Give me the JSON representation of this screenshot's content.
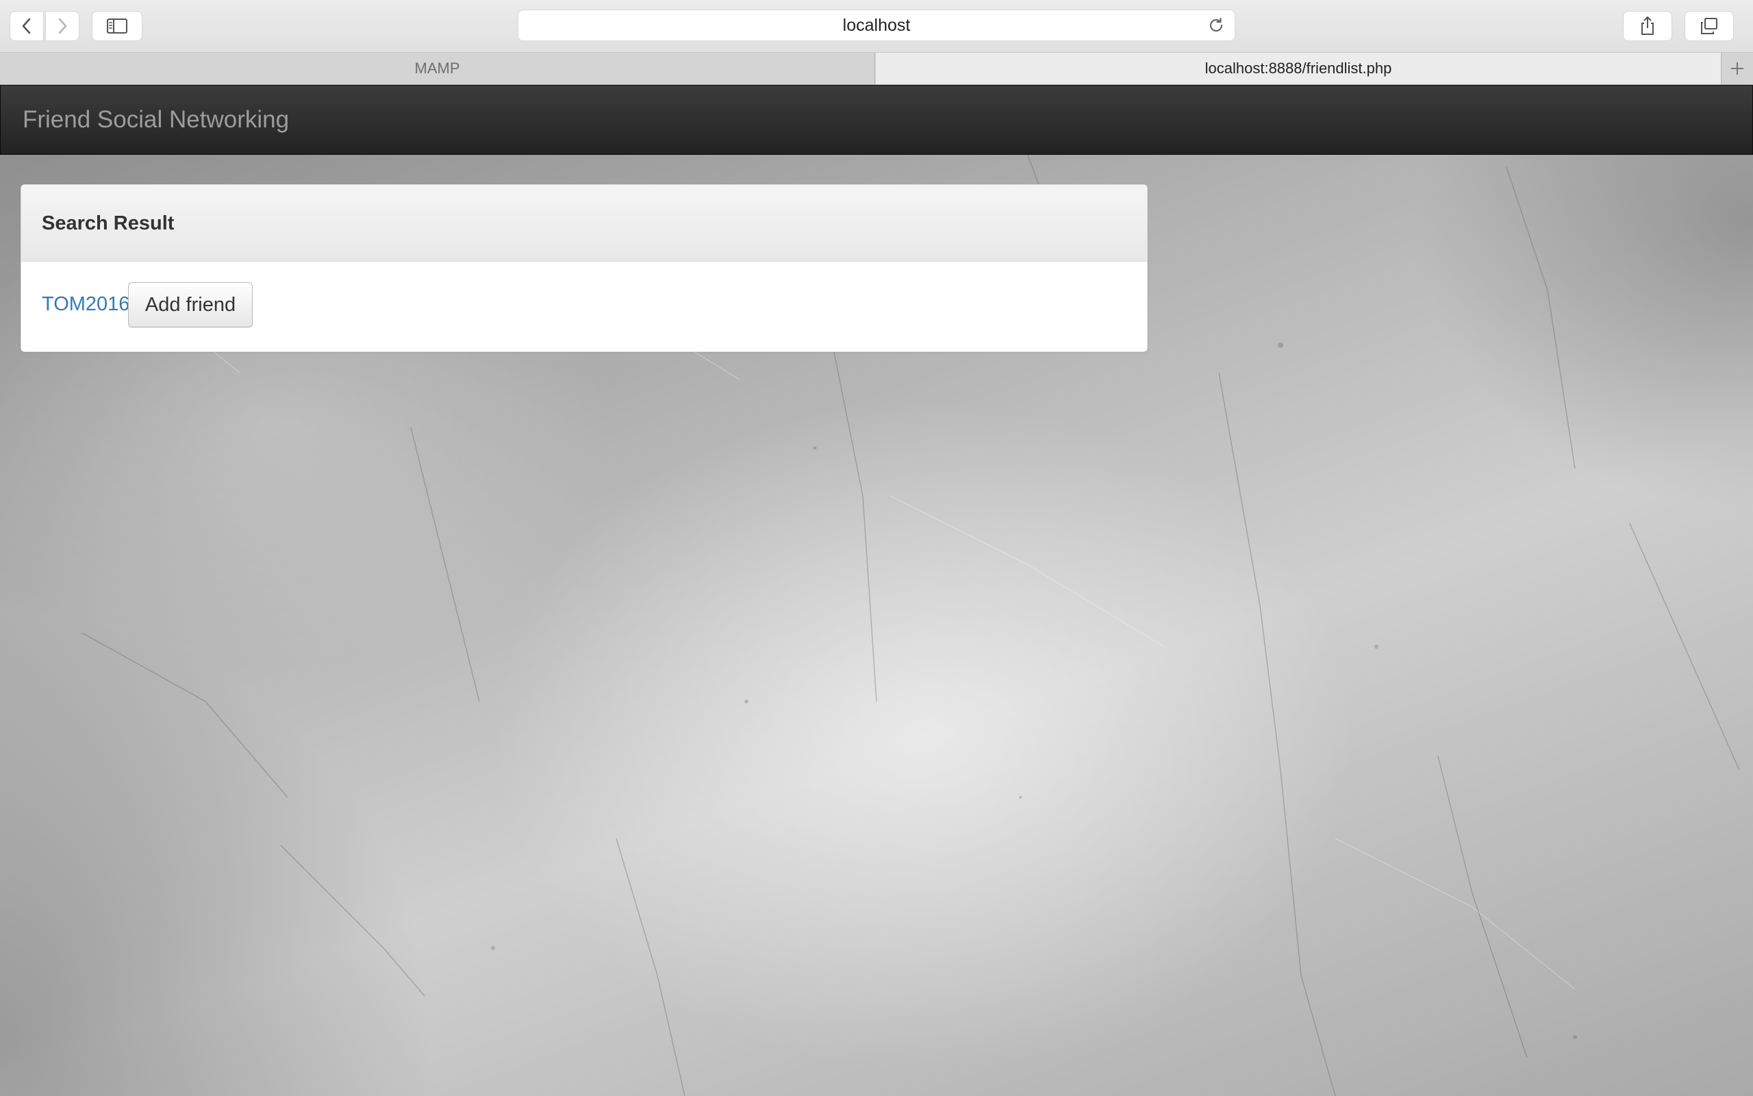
{
  "browser": {
    "address": "localhost",
    "tabs": [
      {
        "label": "MAMP",
        "active": false
      },
      {
        "label": "localhost:8888/friendlist.php",
        "active": true
      }
    ],
    "icons": {
      "back": "chevron-left-icon",
      "forward": "chevron-right-icon",
      "sidebar": "sidebar-icon",
      "reload": "reload-icon",
      "share": "share-icon",
      "tabs": "tabs-overview-icon",
      "new_tab": "plus-icon"
    }
  },
  "navbar": {
    "brand": "Friend Social Networking"
  },
  "search_panel": {
    "title": "Search Result",
    "results": [
      {
        "username": "TOM2016",
        "action_label": "Add friend"
      }
    ]
  },
  "colors": {
    "navbar": "#222222",
    "brand_text": "#9d9d9d",
    "link": "#337ab7"
  }
}
